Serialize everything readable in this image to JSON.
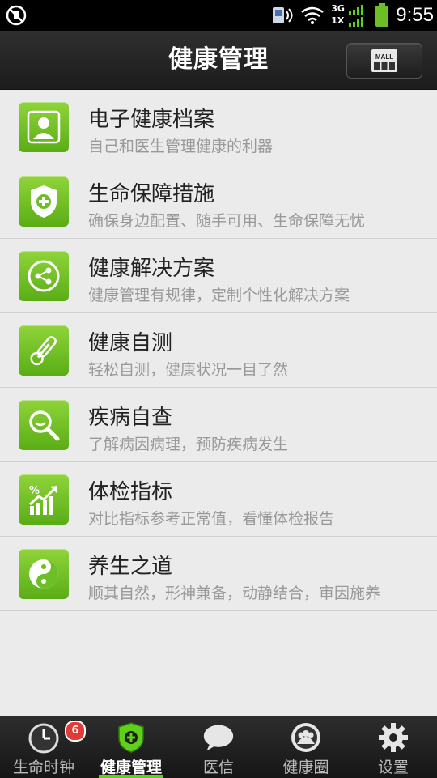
{
  "status_bar": {
    "time": "9:55",
    "network_top": "3G",
    "network_bottom": "1X",
    "icons": [
      "no-sim-icon",
      "speaker-icon",
      "wifi-icon",
      "signal-icon",
      "battery-icon"
    ]
  },
  "header": {
    "title": "健康管理",
    "mall_label": "MALL"
  },
  "menu": [
    {
      "title": "电子健康档案",
      "subtitle": "自己和医生管理健康的利器",
      "icon": "person-icon"
    },
    {
      "title": "生命保障措施",
      "subtitle": "确保身边配置、随手可用、生命保障无忧",
      "icon": "shield-plus-icon"
    },
    {
      "title": "健康解决方案",
      "subtitle": "健康管理有规律，定制个性化解决方案",
      "icon": "share-icon"
    },
    {
      "title": "健康自测",
      "subtitle": "轻松自测，健康状况一目了然",
      "icon": "thermometer-icon"
    },
    {
      "title": "疾病自查",
      "subtitle": "了解病因病理，预防疾病发生",
      "icon": "magnifier-icon"
    },
    {
      "title": "体检指标",
      "subtitle": "对比指标参考正常值，看懂体检报告",
      "icon": "chart-icon"
    },
    {
      "title": "养生之道",
      "subtitle": "顺其自然，形神兼备，动静结合，审因施养",
      "icon": "yinyang-icon"
    }
  ],
  "tabs": [
    {
      "label": "生命时钟",
      "badge": "6",
      "icon": "clock-icon"
    },
    {
      "label": "健康管理",
      "icon": "shield-plus-icon",
      "active": true
    },
    {
      "label": "医信",
      "icon": "chat-bubble-icon"
    },
    {
      "label": "健康圈",
      "icon": "people-icon"
    },
    {
      "label": "设置",
      "icon": "gear-icon"
    }
  ],
  "colors": {
    "accent": "#6cc025",
    "header_bg": "#262626",
    "list_bg": "#ebebeb",
    "badge": "#e23b36"
  }
}
